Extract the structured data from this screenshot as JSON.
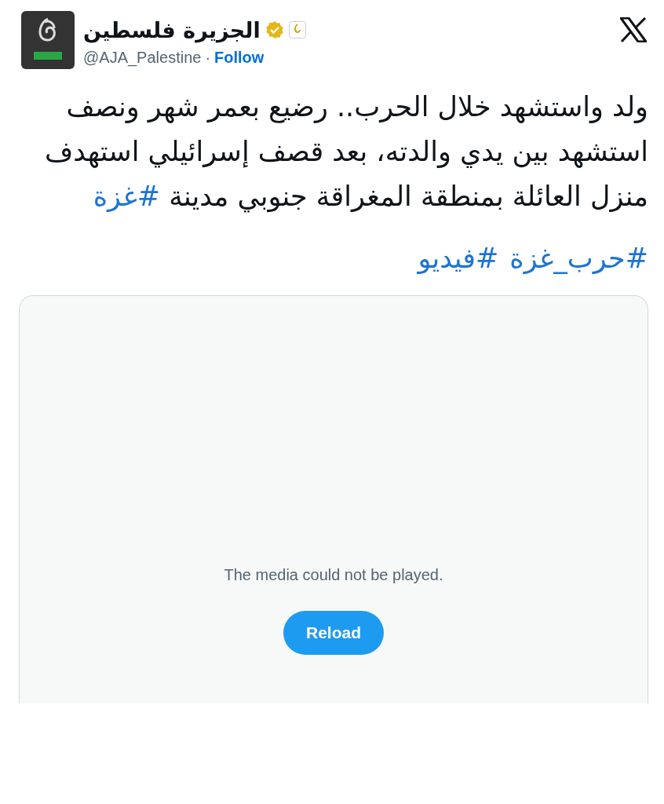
{
  "author": {
    "name": "الجزيرة فلسطين",
    "verified": true,
    "handle": "@AJA_Palestine",
    "separator": "·",
    "follow": "Follow"
  },
  "tweet_text": [
    {
      "kind": "text",
      "text": "ولد واستشهد خلال الحرب.. رضيع بعمر شهر ونصف استشهد بين يدي والدته، بعد قصف إسرائيلي استهدف منزل العائلة بمنطقة المغراقة جنوبي مدينة "
    },
    {
      "kind": "hashtag",
      "text": "#غزة"
    }
  ],
  "hashtags": [
    "#حرب_غزة",
    "#فيديو"
  ],
  "media": {
    "message": "The media could not be played.",
    "button": "Reload"
  }
}
